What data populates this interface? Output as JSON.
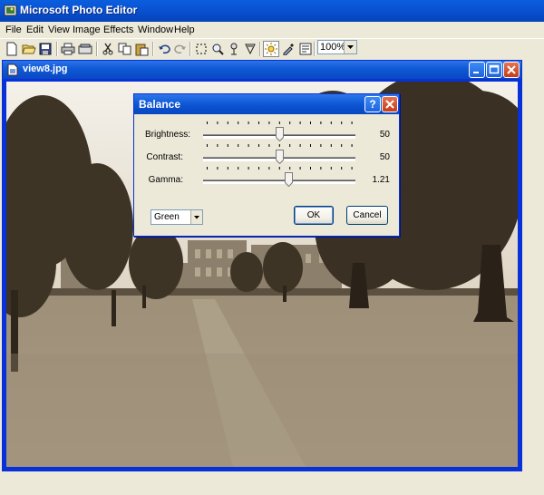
{
  "app": {
    "title": "Microsoft Photo Editor"
  },
  "menu": [
    {
      "label": "File"
    },
    {
      "label": "Edit"
    },
    {
      "label": "View"
    },
    {
      "label": "Image"
    },
    {
      "label": "Effects"
    },
    {
      "label": "Window"
    },
    {
      "label": "Help"
    }
  ],
  "toolbar": {
    "icons": [
      "new-icon",
      "open-icon",
      "save-icon",
      "print-icon",
      "scan-icon",
      "cut-icon",
      "copy-icon",
      "paste-icon",
      "undo-icon",
      "redo-icon",
      "select-icon",
      "zoom-icon",
      "smudge-icon",
      "sharpen-icon",
      "balance-icon",
      "eyedropper-icon",
      "properties-icon"
    ],
    "zoom_value": "100%"
  },
  "document": {
    "title": "view8.jpg"
  },
  "balance_dialog": {
    "title": "Balance",
    "help_label": "?",
    "sliders": [
      {
        "label": "Brightness:",
        "value": "50",
        "position": 0.5
      },
      {
        "label": "Contrast:",
        "value": "50",
        "position": 0.5
      },
      {
        "label": "Gamma:",
        "value": "1.21",
        "position": 0.56
      }
    ],
    "channel_value": "Green",
    "ok_label": "OK",
    "cancel_label": "Cancel"
  },
  "colors": {
    "xp_blue": "#0a50d0",
    "sepia_dark": "#3f3425",
    "sepia_light": "#cfc3ad"
  }
}
